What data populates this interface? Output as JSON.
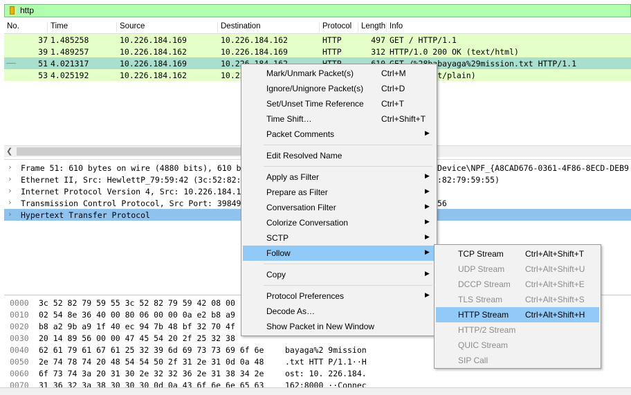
{
  "filter": {
    "value": "http"
  },
  "packet_list": {
    "columns": [
      "No.",
      "Time",
      "Source",
      "Destination",
      "Protocol",
      "Length",
      "Info"
    ],
    "rows": [
      {
        "no": "37",
        "time": "1.485258",
        "source": "10.226.184.169",
        "destination": "10.226.184.162",
        "protocol": "HTTP",
        "length": "497",
        "info": "GET / HTTP/1.1"
      },
      {
        "no": "39",
        "time": "1.489257",
        "source": "10.226.184.162",
        "destination": "10.226.184.169",
        "protocol": "HTTP",
        "length": "312",
        "info": "HTTP/1.0 200 OK  (text/html)"
      },
      {
        "no": "51",
        "time": "4.021317",
        "source": "10.226.184.169",
        "destination": "10.226.184.162",
        "protocol": "HTTP",
        "length": "610",
        "info": "GET /%28babayaga%29mission.txt HTTP/1.1"
      },
      {
        "no": "53",
        "time": "4.025192",
        "source": "10.226.184.162",
        "destination": "10.22",
        "protocol": "",
        "length": "",
        "info": "00 OK  (text/plain)"
      }
    ],
    "selected_row": 2
  },
  "details": [
    {
      "text": "Frame 51: 610 bytes on wire (4880 bits), 610 b",
      "right": "Device\\NPF_{A8CAD676-0361-4F86-8ECD-DEB9"
    },
    {
      "text": "Ethernet II, Src: HewlettP_79:59:42 (3c:52:82:",
      "right": ":82:79:59:55)"
    },
    {
      "text": "Internet Protocol Version 4, Src: 10.226.184.1",
      "right": ""
    },
    {
      "text": "Transmission Control Protocol, Src Port: 39849",
      "right": "56"
    },
    {
      "text": "Hypertext Transfer Protocol",
      "right": ""
    }
  ],
  "bytes": [
    {
      "offset": "0000",
      "hex": "3c 52 82 79 59 55 3c 52  82 79 59 42 08 00",
      "ascii": ""
    },
    {
      "offset": "0010",
      "hex": "02 54 8e 36 40 00 80 06  00 00 0a e2 b8 a9",
      "ascii": ""
    },
    {
      "offset": "0020",
      "hex": "b8 a2 9b a9 1f 40 ec 94  7b 48 bf 32 70 4f",
      "ascii": ""
    },
    {
      "offset": "0030",
      "hex": "20 14 89 56 00 00 47 45  54 20 2f 25 32 38",
      "ascii": ""
    },
    {
      "offset": "0040",
      "hex": "62 61 79 61 67 61 25 32  39 6d 69 73 73 69 6f 6e",
      "ascii": "bayaga%2 9mission"
    },
    {
      "offset": "0050",
      "hex": "2e 74 78 74 20 48 54 54  50 2f 31 2e 31 0d 0a 48",
      "ascii": ".txt HTT P/1.1··H"
    },
    {
      "offset": "0060",
      "hex": "6f 73 74 3a 20 31 30 2e  32 32 36 2e 31 38 34 2e",
      "ascii": "ost: 10. 226.184."
    },
    {
      "offset": "0070",
      "hex": "31 36 32 3a 38 30 30 30  0d 0a 43 6f 6e 6e 65 63",
      "ascii": "162:8000 ··Connec"
    }
  ],
  "context_menu": {
    "items": [
      {
        "label": "Mark/Unmark Packet(s)",
        "shortcut": "Ctrl+M"
      },
      {
        "label": "Ignore/Unignore Packet(s)",
        "shortcut": "Ctrl+D"
      },
      {
        "label": "Set/Unset Time Reference",
        "shortcut": "Ctrl+T"
      },
      {
        "label": "Time Shift…",
        "shortcut": "Ctrl+Shift+T"
      },
      {
        "label": "Packet Comments",
        "submenu": true
      },
      {
        "separator": true
      },
      {
        "label": "Edit Resolved Name"
      },
      {
        "separator": true
      },
      {
        "label": "Apply as Filter",
        "submenu": true
      },
      {
        "label": "Prepare as Filter",
        "submenu": true
      },
      {
        "label": "Conversation Filter",
        "submenu": true
      },
      {
        "label": "Colorize Conversation",
        "submenu": true
      },
      {
        "label": "SCTP",
        "submenu": true
      },
      {
        "label": "Follow",
        "submenu": true,
        "active": true
      },
      {
        "separator": true
      },
      {
        "label": "Copy",
        "submenu": true
      },
      {
        "separator": true
      },
      {
        "label": "Protocol Preferences",
        "submenu": true
      },
      {
        "label": "Decode As…"
      },
      {
        "label": "Show Packet in New Window"
      }
    ]
  },
  "follow_submenu": {
    "items": [
      {
        "label": "TCP Stream",
        "shortcut": "Ctrl+Alt+Shift+T",
        "enabled": true
      },
      {
        "label": "UDP Stream",
        "shortcut": "Ctrl+Alt+Shift+U",
        "enabled": false
      },
      {
        "label": "DCCP Stream",
        "shortcut": "Ctrl+Alt+Shift+E",
        "enabled": false
      },
      {
        "label": "TLS Stream",
        "shortcut": "Ctrl+Alt+Shift+S",
        "enabled": false
      },
      {
        "label": "HTTP Stream",
        "shortcut": "Ctrl+Alt+Shift+H",
        "enabled": true,
        "active": true
      },
      {
        "label": "HTTP/2 Stream",
        "enabled": false
      },
      {
        "label": "QUIC Stream",
        "enabled": false
      },
      {
        "label": "SIP Call",
        "enabled": false
      }
    ]
  },
  "icons": {
    "filter_bookmark": "bookmark-icon",
    "expand": "chevron-right-icon",
    "submenu": "triangle-right-icon",
    "scroll_left": "chevron-left-icon"
  },
  "colors": {
    "filter_valid": "#afffaf",
    "http_row": "#e4ffc7",
    "selected_row": "#a8dfcf",
    "selected_detail": "#8fc3ef",
    "menu_highlight": "#91c9f7"
  }
}
